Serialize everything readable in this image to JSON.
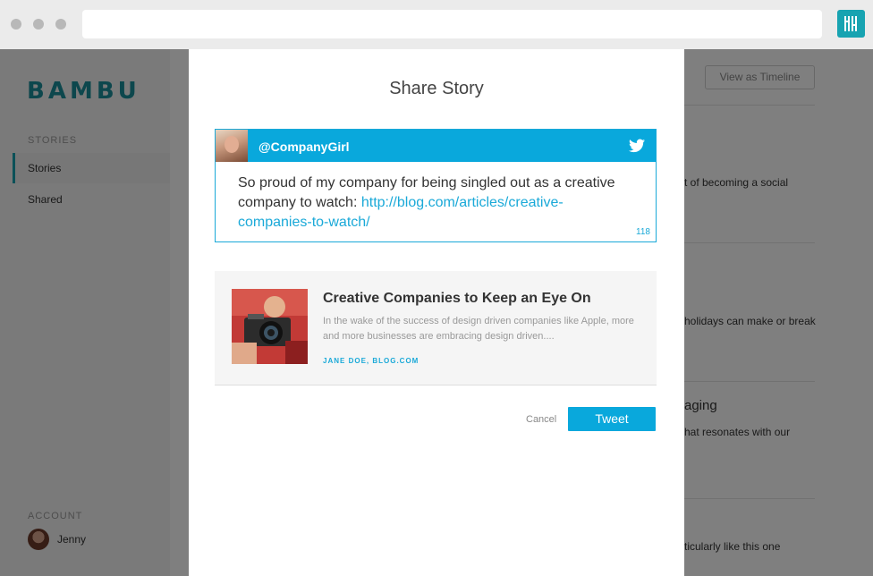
{
  "browser": {
    "url": "",
    "extension_icon": "bambu-extension-icon"
  },
  "app": {
    "logo": "BAMBU",
    "sidebar": {
      "section_stories": "STORIES",
      "items": [
        {
          "label": "Stories",
          "active": true
        },
        {
          "label": "Shared",
          "active": false
        }
      ],
      "section_account": "ACCOUNT",
      "user_name": "Jenny"
    },
    "main": {
      "view_timeline_label": "View as Timeline",
      "stories": [
        {
          "fragment": "t of becoming a social"
        },
        {
          "fragment": "holidays can make or break"
        },
        {
          "title_fragment": "aging",
          "fragment": "hat resonates with our"
        },
        {
          "fragment": "ticularly like this one"
        }
      ]
    }
  },
  "modal": {
    "title": "Share Story",
    "tweet": {
      "handle": "@CompanyGirl",
      "text": "So proud of my company for being singled out as a creative company to watch: ",
      "link": "http://blog.com/articles/creative-companies-to-watch/",
      "char_count": "118"
    },
    "card": {
      "title": "Creative Companies to Keep an Eye On",
      "description": "In the wake of the success of design driven companies like Apple, more and more businesses are embracing design driven....",
      "meta": "JANE DOE, BLOG.COM"
    },
    "cancel_label": "Cancel",
    "tweet_button_label": "Tweet"
  },
  "colors": {
    "accent": "#09a8dc",
    "brand": "#1b8f9a",
    "overlay": "rgba(0,0,0,0.5)"
  }
}
